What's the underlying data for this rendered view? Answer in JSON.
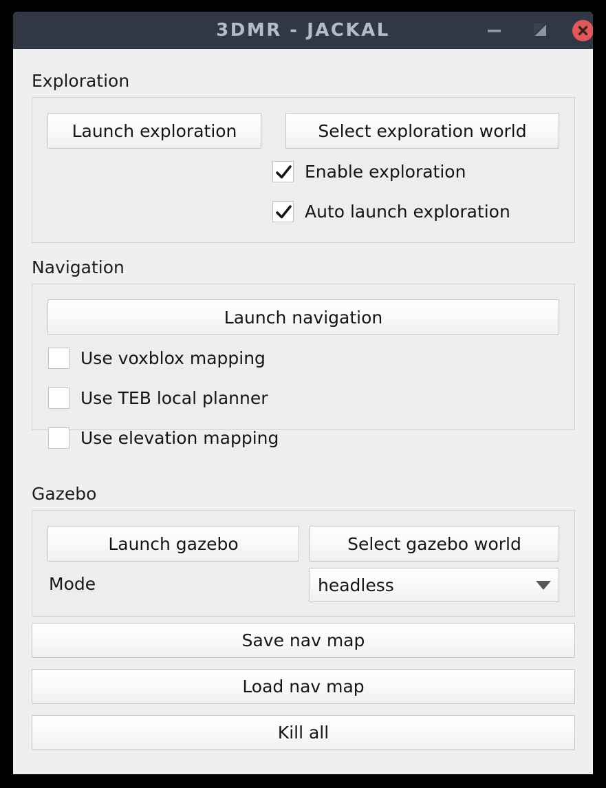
{
  "window": {
    "title": "3DMR - JACKAL",
    "titlebar_color": "#313745",
    "title_color": "#b4bccb",
    "body_color": "#efefef",
    "close_color": "#e0585c",
    "controls": {
      "minimize": "minimize",
      "maximize": "maximize",
      "close": "close"
    }
  },
  "sections": {
    "exploration": {
      "title": "Exploration",
      "launch_button": "Launch exploration",
      "select_world_button": "Select exploration world",
      "checkboxes": [
        {
          "label": "Enable exploration",
          "checked": true
        },
        {
          "label": "Auto launch exploration",
          "checked": true
        }
      ]
    },
    "navigation": {
      "title": "Navigation",
      "launch_button": "Launch navigation",
      "checkboxes": [
        {
          "label": "Use voxblox mapping",
          "checked": false
        },
        {
          "label": "Use TEB local planner",
          "checked": false
        },
        {
          "label": "Use elevation mapping",
          "checked": false
        }
      ]
    },
    "gazebo": {
      "title": "Gazebo",
      "launch_button": "Launch gazebo",
      "select_world_button": "Select gazebo world",
      "mode_label": "Mode",
      "mode_value": "headless",
      "mode_options": [
        "headless"
      ]
    }
  },
  "bottom_actions": [
    {
      "label": "Save nav map"
    },
    {
      "label": "Load nav map"
    },
    {
      "label": "Kill all"
    }
  ]
}
